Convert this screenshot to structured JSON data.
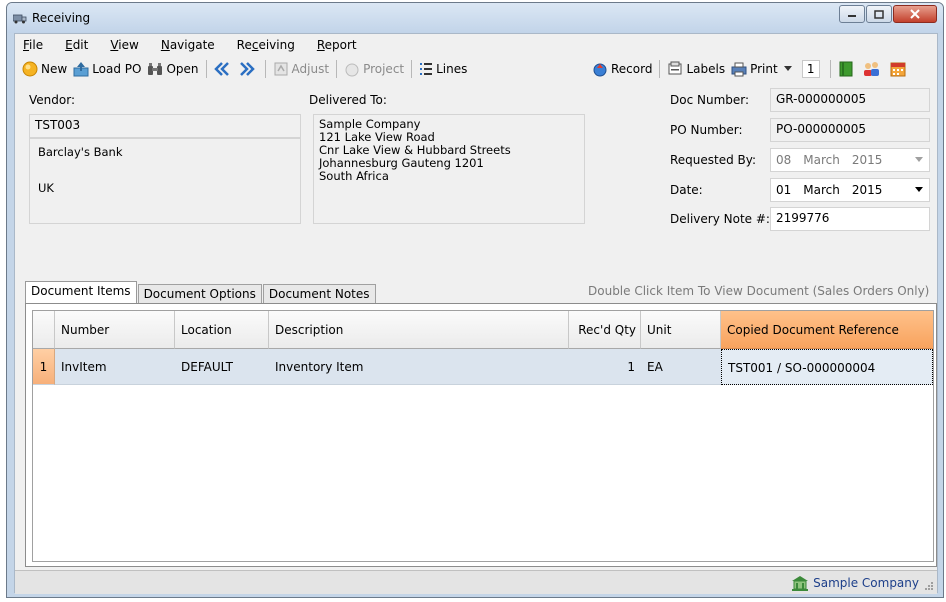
{
  "window": {
    "title": "Receiving"
  },
  "menu": [
    {
      "pre": "",
      "key": "F",
      "post": "ile"
    },
    {
      "pre": "",
      "key": "E",
      "post": "dit"
    },
    {
      "pre": "",
      "key": "V",
      "post": "iew"
    },
    {
      "pre": "",
      "key": "N",
      "post": "avigate"
    },
    {
      "pre": "Re",
      "key": "c",
      "post": "eiving"
    },
    {
      "pre": "",
      "key": "R",
      "post": "eport"
    }
  ],
  "toolbar": {
    "new": "New",
    "load_po": "Load PO",
    "open": "Open",
    "adjust": "Adjust",
    "project": "Project",
    "lines": "Lines",
    "record": "Record",
    "labels": "Labels",
    "print": "Print",
    "copies": "1"
  },
  "vendor": {
    "label": "Vendor:",
    "code": "TST003",
    "name": "Barclay's Bank",
    "country": "UK"
  },
  "delivered_to": {
    "label": "Delivered To:",
    "lines": [
      "Sample Company",
      "121 Lake View Road",
      "Cnr Lake View & Hubbard Streets",
      "Johannesburg  Gauteng  1201",
      "South Africa"
    ]
  },
  "doc": {
    "doc_number_label": "Doc Number:",
    "doc_number": "GR-000000005",
    "po_number_label": "PO Number:",
    "po_number": "PO-000000005",
    "requested_by_label": "Requested By:",
    "requested_by": {
      "day": "08",
      "month": "March",
      "year": "2015"
    },
    "date_label": "Date:",
    "date": {
      "day": "01",
      "month": "March",
      "year": "2015"
    },
    "delivery_note_label": "Delivery Note #:",
    "delivery_note": "2199776"
  },
  "tabs": [
    "Document Items",
    "Document Options",
    "Document Notes"
  ],
  "tab_hint": "Double Click Item To View Document (Sales Orders Only)",
  "grid": {
    "columns": [
      "Number",
      "Location",
      "Description",
      "Rec'd Qty",
      "Unit",
      "Copied Document Reference"
    ],
    "rows": [
      {
        "index": "1",
        "number": "InvItem",
        "location": "DEFAULT",
        "description": "Inventory Item",
        "qty": "1",
        "unit": "EA",
        "reference": "TST001 / SO-000000004"
      }
    ]
  },
  "status": {
    "company": "Sample Company"
  },
  "colors": {
    "selected_header": "#f8a35e",
    "row_bg": "#dbe4ee",
    "status_text": "#1d3f8a"
  }
}
